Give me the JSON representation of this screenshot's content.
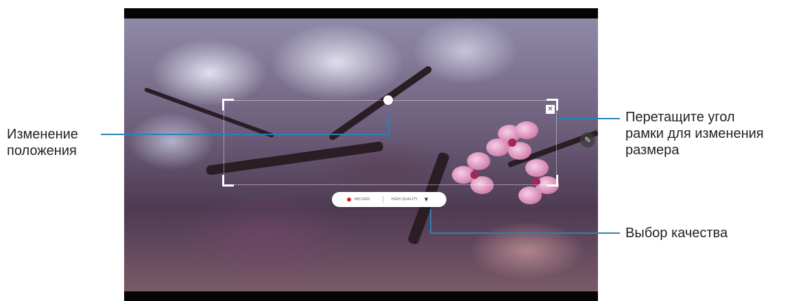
{
  "callouts": {
    "reposition": "Изменение\nположения",
    "resize": "Перетащите угол\nрамки для изменения\nразмера",
    "quality": "Выбор качества"
  },
  "record_bar": {
    "record_label": "RECORD",
    "quality_label": "HIGH QUALITY",
    "dropdown_icon": "chevron-down-icon"
  },
  "controls": {
    "close_icon": "close-icon",
    "close_glyph": "✕",
    "edit_icon": "pencil-icon",
    "edit_glyph": "✎"
  },
  "colors": {
    "leader_line": "#2d7fb8",
    "record_dot": "#d32020"
  }
}
